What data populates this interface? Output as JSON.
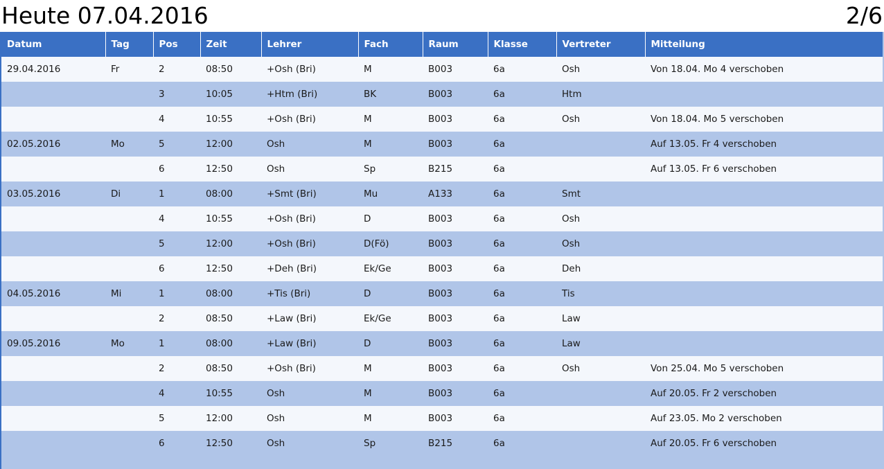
{
  "header": {
    "title": "Heute 07.04.2016",
    "page_indicator": "2/6"
  },
  "colors": {
    "header_bg": "#3a70c4",
    "row_light": "#f4f7fc",
    "row_dark": "#b0c5e8"
  },
  "table": {
    "columns": [
      "Datum",
      "Tag",
      "Pos",
      "Zeit",
      "Lehrer",
      "Fach",
      "Raum",
      "Klasse",
      "Vertreter",
      "Mitteilung"
    ],
    "rows": [
      [
        "29.04.2016",
        "Fr",
        "2",
        "08:50",
        "+Osh (Bri)",
        "M",
        "B003",
        "6a",
        "Osh",
        "Von 18.04. Mo 4 verschoben"
      ],
      [
        "",
        "",
        "3",
        "10:05",
        "+Htm (Bri)",
        "BK",
        "B003",
        "6a",
        "Htm",
        ""
      ],
      [
        "",
        "",
        "4",
        "10:55",
        "+Osh (Bri)",
        "M",
        "B003",
        "6a",
        "Osh",
        "Von 18.04. Mo 5 verschoben"
      ],
      [
        "02.05.2016",
        "Mo",
        "5",
        "12:00",
        "Osh",
        "M",
        "B003",
        "6a",
        "",
        "Auf 13.05. Fr 4 verschoben"
      ],
      [
        "",
        "",
        "6",
        "12:50",
        "Osh",
        "Sp",
        "B215",
        "6a",
        "",
        "Auf 13.05. Fr 6 verschoben"
      ],
      [
        "03.05.2016",
        "Di",
        "1",
        "08:00",
        "+Smt (Bri)",
        "Mu",
        "A133",
        "6a",
        "Smt",
        ""
      ],
      [
        "",
        "",
        "4",
        "10:55",
        "+Osh (Bri)",
        "D",
        "B003",
        "6a",
        "Osh",
        ""
      ],
      [
        "",
        "",
        "5",
        "12:00",
        "+Osh (Bri)",
        "D(Fö)",
        "B003",
        "6a",
        "Osh",
        ""
      ],
      [
        "",
        "",
        "6",
        "12:50",
        "+Deh (Bri)",
        "Ek/Ge",
        "B003",
        "6a",
        "Deh",
        ""
      ],
      [
        "04.05.2016",
        "Mi",
        "1",
        "08:00",
        "+Tis (Bri)",
        "D",
        "B003",
        "6a",
        "Tis",
        ""
      ],
      [
        "",
        "",
        "2",
        "08:50",
        "+Law (Bri)",
        "Ek/Ge",
        "B003",
        "6a",
        "Law",
        ""
      ],
      [
        "09.05.2016",
        "Mo",
        "1",
        "08:00",
        "+Law (Bri)",
        "D",
        "B003",
        "6a",
        "Law",
        ""
      ],
      [
        "",
        "",
        "2",
        "08:50",
        "+Osh (Bri)",
        "M",
        "B003",
        "6a",
        "Osh",
        "Von 25.04. Mo 5 verschoben"
      ],
      [
        "",
        "",
        "4",
        "10:55",
        "Osh",
        "M",
        "B003",
        "6a",
        "",
        "Auf 20.05. Fr 2 verschoben"
      ],
      [
        "",
        "",
        "5",
        "12:00",
        "Osh",
        "M",
        "B003",
        "6a",
        "",
        "Auf 23.05. Mo 2 verschoben"
      ],
      [
        "",
        "",
        "6",
        "12:50",
        "Osh",
        "Sp",
        "B215",
        "6a",
        "",
        "Auf 20.05. Fr 6 verschoben"
      ]
    ]
  }
}
